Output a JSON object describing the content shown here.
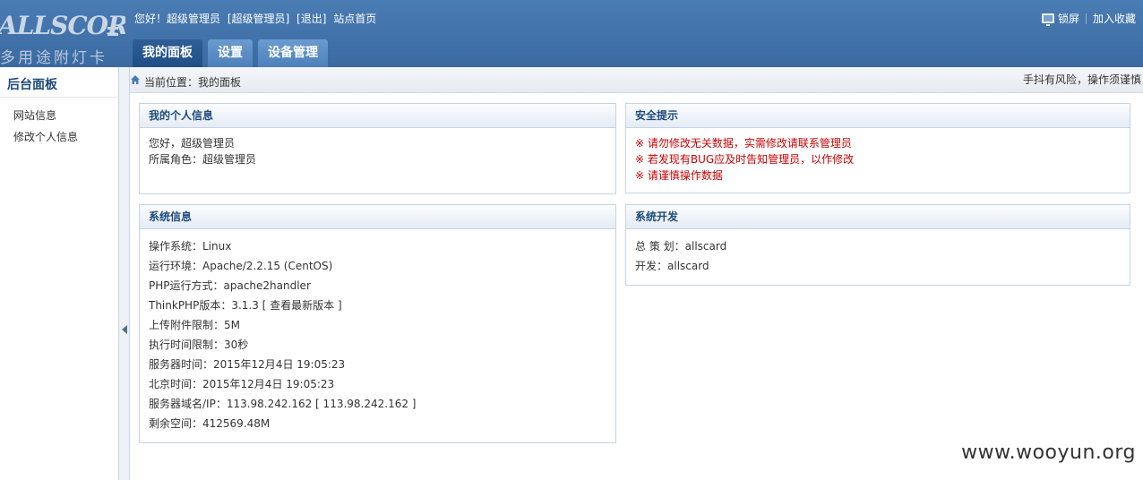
{
  "header": {
    "logo_text": "ALLSCOR",
    "logo_sub": "多用途附灯卡",
    "user": {
      "greeting": "您好！超级管理员",
      "role_tag": "[超级管理员]",
      "logout": "[退出]",
      "home": "站点首页"
    },
    "right": {
      "lock": "锁屏",
      "bookmark": "加入收藏"
    }
  },
  "tabs": [
    {
      "label": "我的面板",
      "active": true
    },
    {
      "label": "设置"
    },
    {
      "label": "设备管理"
    }
  ],
  "sidebar": {
    "title": "后台面板",
    "items": [
      {
        "label": "网站信息"
      },
      {
        "label": "修改个人信息"
      }
    ]
  },
  "crumb": {
    "text": "当前位置：我的面板",
    "notice": "手抖有风险，操作须谨慎"
  },
  "panels": {
    "personal": {
      "title": "我的个人信息",
      "lines": [
        "您好，超级管理员",
        "所属角色：超级管理员"
      ]
    },
    "security": {
      "title": "安全提示",
      "lines": [
        "※ 请勿修改无关数据，实需修改请联系管理员",
        "※ 若发现有BUG应及时告知管理员，以作修改",
        "※ 请谨慎操作数据"
      ]
    },
    "sysinfo": {
      "title": "系统信息",
      "lines": [
        "操作系统：Linux",
        "运行环境：Apache/2.2.15 (CentOS)",
        "PHP运行方式：apache2handler",
        "ThinkPHP版本：3.1.3 [ 查看最新版本 ]",
        "上传附件限制：5M",
        "执行时间限制：30秒",
        "服务器时间：2015年12月4日 19:05:23",
        "北京时间：2015年12月4日 19:05:23",
        "服务器域名/IP：113.98.242.162 [ 113.98.242.162 ]",
        "剩余空间：412569.48M"
      ]
    },
    "dev": {
      "title": "系统开发",
      "lines": [
        "总 策 划：allscard",
        "开发：allscard"
      ]
    }
  },
  "watermark": "www.wooyun.org",
  "colors": {
    "header_bg": "#3d6ea5",
    "tab_active": "#1f4f86",
    "panel_title": "#1d4a7c",
    "warning_red": "#cc0000"
  }
}
